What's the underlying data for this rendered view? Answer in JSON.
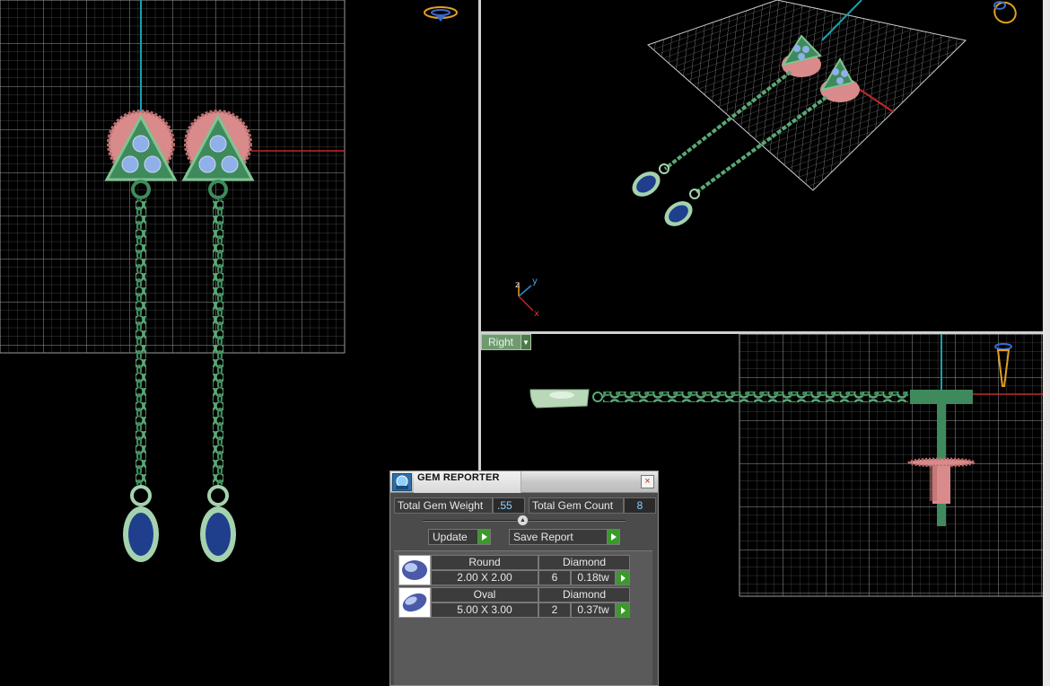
{
  "viewports": {
    "right_view_label": "Right",
    "axis_labels": {
      "z": "z",
      "y": "y",
      "x": "x"
    }
  },
  "gem_reporter": {
    "title": "GEM REPORTER",
    "close_glyph": "×",
    "total_weight_label": "Total Gem Weight",
    "total_weight_value": ".55",
    "total_count_label": "Total Gem Count",
    "total_count_value": "8",
    "update_label": "Update",
    "save_report_label": "Save Report",
    "gems": [
      {
        "shape": "Round",
        "material": "Diamond",
        "size": "2.00 X 2.00",
        "count": "6",
        "weight": "0.18tw"
      },
      {
        "shape": "Oval",
        "material": "Diamond",
        "size": "5.00 X 3.00",
        "count": "2",
        "weight": "0.37tw"
      }
    ]
  },
  "colors": {
    "metal_green": "#3f8a5c",
    "metal_light": "#7fc492",
    "prong_pink": "#d98a8a",
    "gem_blue": "#1f3f8c",
    "gem_light": "#a8c2ee",
    "grid": "#9a9a9a",
    "axis_red": "#c0282a",
    "axis_cyan": "#1aa0b0",
    "accent_green": "#3a9a2a"
  }
}
